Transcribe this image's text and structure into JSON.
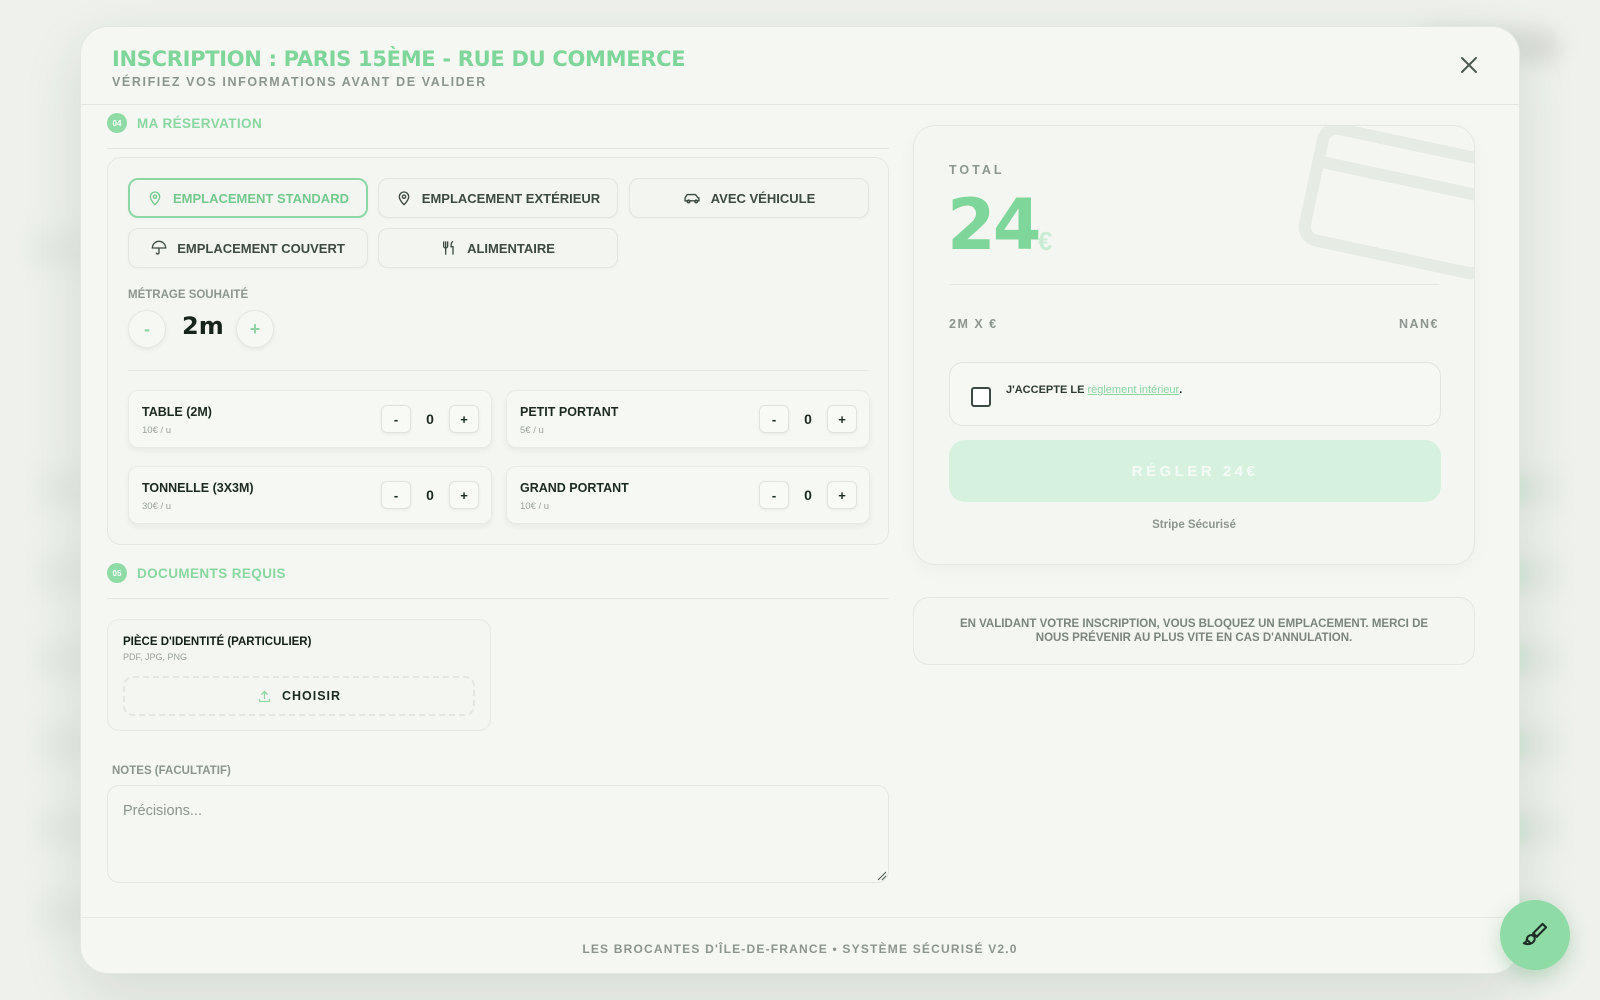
{
  "modal": {
    "title": "INSCRIPTION : PARIS 15ÈME - RUE DU COMMERCE",
    "subtitle": "VÉRIFIEZ VOS INFORMATIONS AVANT DE VALIDER",
    "close_icon": "close-icon"
  },
  "reservation": {
    "step": "04",
    "title": "MA RÉSERVATION",
    "types": [
      {
        "label": "EMPLACEMENT STANDARD",
        "icon": "map-pin-icon",
        "active": true
      },
      {
        "label": "EMPLACEMENT EXTÉRIEUR",
        "icon": "map-pin-icon",
        "active": false
      },
      {
        "label": "AVEC VÉHICULE",
        "icon": "car-icon",
        "active": false
      },
      {
        "label": "EMPLACEMENT COUVERT",
        "icon": "umbrella-icon",
        "active": false
      },
      {
        "label": "ALIMENTAIRE",
        "icon": "utensils-icon",
        "active": false
      }
    ],
    "metrage_label": "MÉTRAGE SOUHAITÉ",
    "metrage_value": "2m",
    "minus": "-",
    "plus": "+",
    "options": [
      {
        "name": "TABLE (2M)",
        "price": "10€ / u",
        "qty": "0"
      },
      {
        "name": "PETIT PORTANT",
        "price": "5€ / u",
        "qty": "0"
      },
      {
        "name": "TONNELLE (3X3M)",
        "price": "30€ / u",
        "qty": "0"
      },
      {
        "name": "GRAND PORTANT",
        "price": "10€ / u",
        "qty": "0"
      }
    ]
  },
  "documents": {
    "step": "05",
    "title": "DOCUMENTS REQUIS",
    "items": [
      {
        "title": "PIÈCE D'IDENTITÉ (PARTICULIER)",
        "formats": "PDF, JPG, PNG",
        "button": "CHOISIR"
      }
    ]
  },
  "notes": {
    "label": "NOTES (FACULTATIF)",
    "placeholder": "Précisions..."
  },
  "summary": {
    "total_label": "TOTAL",
    "total_amount": "24",
    "currency": "€",
    "calc_label": "2M X €",
    "calc_value": "NAN€",
    "accept_prefix": "J'ACCEPTE LE ",
    "accept_link": "règlement intérieur",
    "accept_suffix": ".",
    "pay_button": "RÉGLER 24€",
    "stripe_note": "Stripe Sécurisé"
  },
  "notice": "EN VALIDANT VOTRE INSCRIPTION, VOUS BLOQUEZ UN EMPLACEMENT. MERCI DE NOUS PRÉVENIR AU PLUS VITE EN CAS D'ANNULATION.",
  "footer": "LES BROCANTES D'ÎLE-DE-FRANCE • SYSTÈME SÉCURISÉ V2.0",
  "fab_icon": "paintbrush-icon",
  "colors": {
    "accent": "#7fd69a",
    "accent_light": "#d6f2de",
    "muted": "#8c958f",
    "background": "#f5f7f2"
  }
}
